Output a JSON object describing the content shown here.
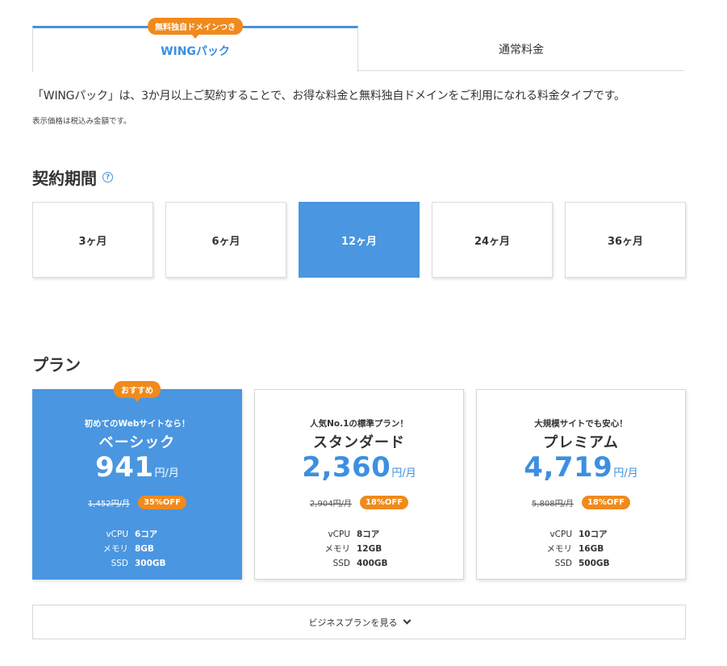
{
  "tabs": {
    "wing": {
      "label": "WINGパック",
      "badge": "無料独自ドメインつき"
    },
    "normal": {
      "label": "通常料金"
    }
  },
  "description": "「WINGパック」は、3か月以上ご契約することで、お得な料金と無料独自ドメインをご利用になれる料金タイプです。",
  "note": "表示価格は税込み金額です。",
  "period_section": {
    "title": "契約期間",
    "help_icon": "question-circle-icon",
    "options": [
      "3ヶ月",
      "6ヶ月",
      "12ヶ月",
      "24ヶ月",
      "36ヶ月"
    ],
    "selected": "12ヶ月"
  },
  "plan_section": {
    "title": "プラン",
    "plans": [
      {
        "badge": "おすすめ",
        "tagline": "初めてのWebサイトなら！",
        "name": "ベーシック",
        "price": "941",
        "unit": "円/月",
        "old_price": "1,452円/月",
        "discount": "35%OFF",
        "specs": [
          {
            "label": "vCPU",
            "value": "6コア"
          },
          {
            "label": "メモリ",
            "value": "8GB"
          },
          {
            "label": "SSD",
            "value": "300GB"
          }
        ]
      },
      {
        "tagline": "人気No.1の標準プラン！",
        "name": "スタンダード",
        "price": "2,360",
        "unit": "円/月",
        "old_price": "2,904円/月",
        "discount": "18%OFF",
        "specs": [
          {
            "label": "vCPU",
            "value": "8コア"
          },
          {
            "label": "メモリ",
            "value": "12GB"
          },
          {
            "label": "SSD",
            "value": "400GB"
          }
        ]
      },
      {
        "tagline": "大規模サイトでも安心！",
        "name": "プレミアム",
        "price": "4,719",
        "unit": "円/月",
        "old_price": "5,808円/月",
        "discount": "18%OFF",
        "specs": [
          {
            "label": "vCPU",
            "value": "10コア"
          },
          {
            "label": "メモリ",
            "value": "16GB"
          },
          {
            "label": "SSD",
            "value": "500GB"
          }
        ]
      }
    ]
  },
  "business_button": {
    "label": "ビジネスプランを見る",
    "icon": "chevron-down-icon"
  },
  "colors": {
    "accent": "#4a96e0",
    "badge": "#f08a1c",
    "text": "#333333"
  }
}
